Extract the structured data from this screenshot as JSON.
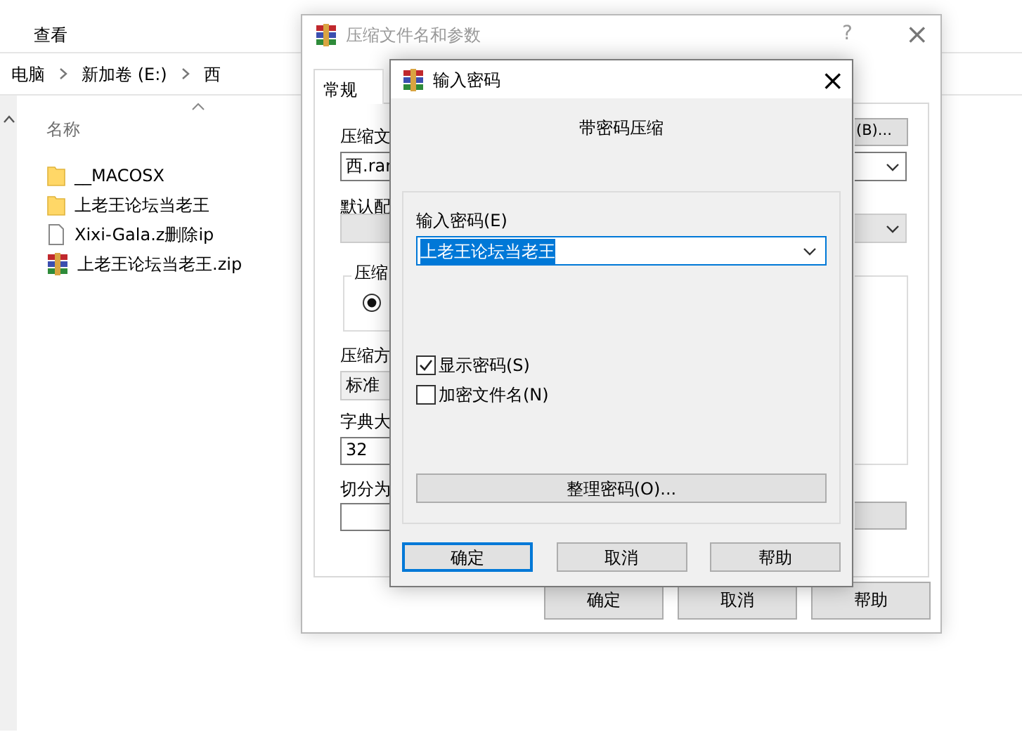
{
  "explorer": {
    "ribbon_tab": "查看",
    "breadcrumb": [
      "电脑",
      "新加卷 (E:)",
      "西"
    ],
    "column_header": "名称",
    "files": [
      {
        "name": "__MACOSX",
        "kind": "folder"
      },
      {
        "name": "上老王论坛当老王",
        "kind": "folder"
      },
      {
        "name": "Xixi-Gala.z删除ip",
        "kind": "file"
      },
      {
        "name": "上老王论坛当老王.zip",
        "kind": "archive"
      }
    ]
  },
  "archive_dialog": {
    "title": "压缩文件名和参数",
    "help": "?",
    "close": "×",
    "tabs": [
      {
        "label": "常规",
        "selected": true
      }
    ],
    "filename_label": "压缩文",
    "filename_value": "西.rar",
    "browse_button": "(B)...",
    "profile_label": "默认配",
    "format_group": "压缩",
    "format_radio_selected": true,
    "method_label": "压缩方",
    "method_value": "标准",
    "dict_label": "字典大",
    "dict_value": "32",
    "split_label": "切分为",
    "buttons": [
      "确定",
      "取消",
      "帮助"
    ]
  },
  "password_dialog": {
    "title": "输入密码",
    "close": "×",
    "heading": "带密码压缩",
    "password_label": "输入密码(E)",
    "password_value": "上老王论坛当老王",
    "options": [
      {
        "label": "显示密码(S)",
        "checked": true
      },
      {
        "label": "加密文件名(N)",
        "checked": false
      }
    ],
    "organize_button": "整理密码(O)...",
    "buttons": [
      {
        "label": "确定",
        "default": true
      },
      {
        "label": "取消",
        "default": false
      },
      {
        "label": "帮助",
        "default": false
      }
    ]
  }
}
